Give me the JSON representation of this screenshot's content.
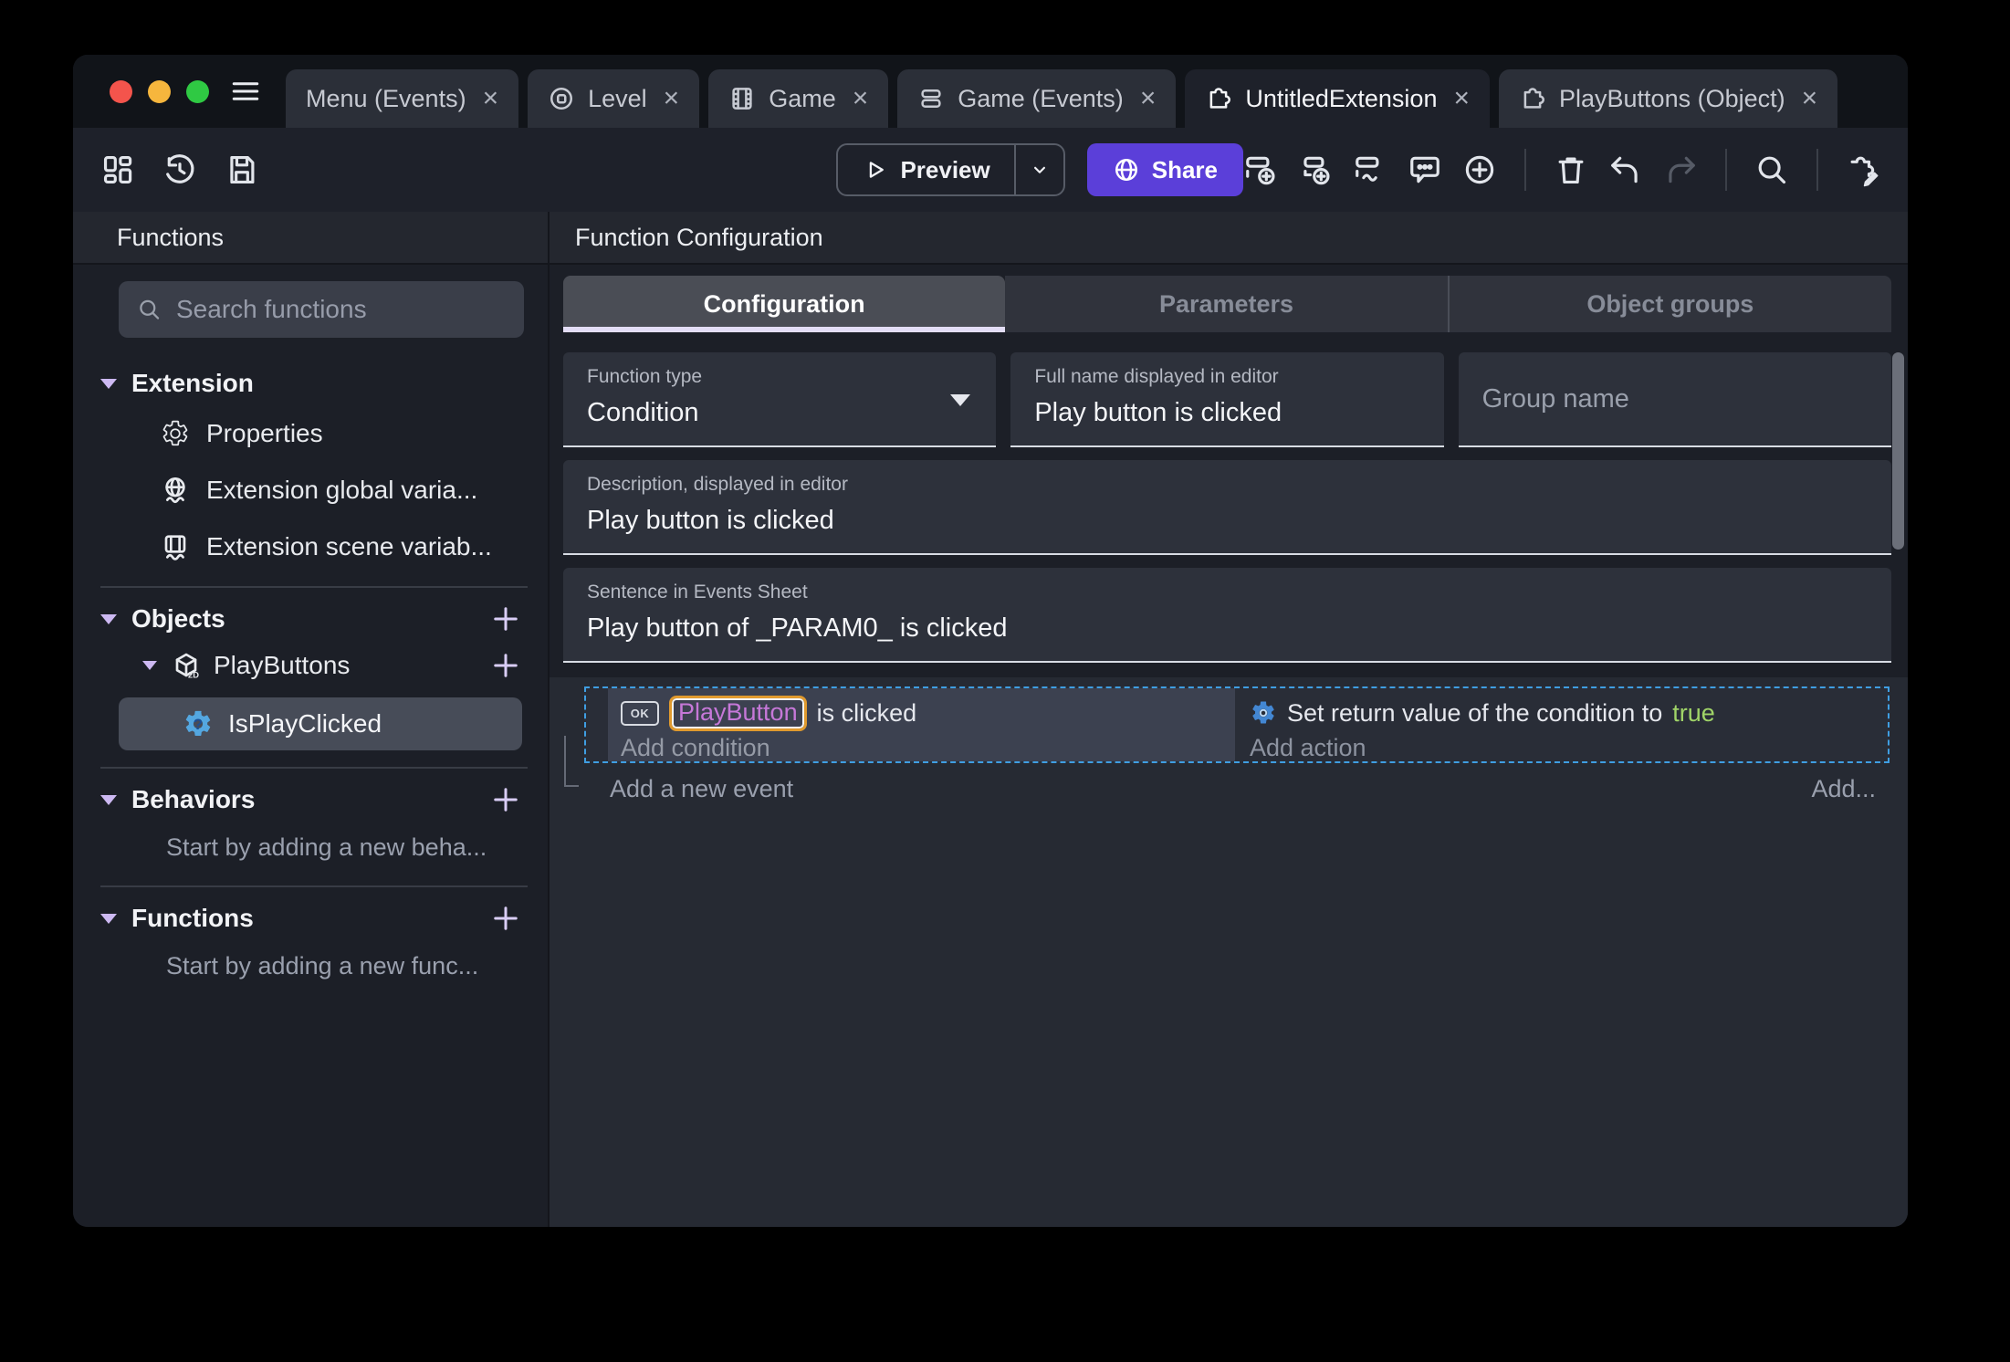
{
  "colors": {
    "accent_purple": "#5b3fd9",
    "accent_lavender": "#d9cdf6",
    "selection_blue": "#3f9ee2",
    "object_highlight_orange": "#e09a2e",
    "object_text_violet": "#c678d8",
    "true_green": "#a0d468",
    "traffic_red": "#f4544c",
    "traffic_yellow": "#f6b63d",
    "traffic_green": "#2fc943"
  },
  "tabbar": {
    "close_glyph": "×",
    "tabs": [
      {
        "label": "Menu (Events)"
      },
      {
        "label": "Level"
      },
      {
        "label": "Game"
      },
      {
        "label": "Game (Events)"
      },
      {
        "label": "UntitledExtension"
      },
      {
        "label": "PlayButtons (Object)"
      }
    ]
  },
  "toolbar": {
    "preview": "Preview",
    "share": "Share"
  },
  "sidebar": {
    "title": "Functions",
    "search_placeholder": "Search functions",
    "extension_section": {
      "label": "Extension",
      "items": [
        {
          "label": "Properties"
        },
        {
          "label": "Extension global varia..."
        },
        {
          "label": "Extension scene variab..."
        }
      ]
    },
    "objects_section": {
      "label": "Objects",
      "object": "PlayButtons",
      "function": "IsPlayClicked"
    },
    "behaviors_section": {
      "label": "Behaviors",
      "hint": "Start by adding a new beha..."
    },
    "functions_section": {
      "label": "Functions",
      "hint": "Start by adding a new func..."
    }
  },
  "main": {
    "title": "Function Configuration",
    "tabs": [
      {
        "label": "Configuration"
      },
      {
        "label": "Parameters"
      },
      {
        "label": "Object groups"
      }
    ],
    "fields": {
      "function_type_label": "Function type",
      "function_type_value": "Condition",
      "full_name_label": "Full name displayed in editor",
      "full_name_value": "Play button is clicked",
      "group_name_placeholder": "Group name",
      "description_label": "Description, displayed in editor",
      "description_value": "Play button is clicked",
      "sentence_label": "Sentence in Events Sheet",
      "sentence_value": "Play button of _PARAM0_ is clicked"
    },
    "events": {
      "condition_object_icon": "OK",
      "condition_object": "PlayButton",
      "condition_text": "is clicked",
      "add_condition": "Add condition",
      "action_text": "Set return value of the condition to",
      "action_value": "true",
      "add_action": "Add action",
      "add_event": "Add a new event",
      "add_more": "Add...",
      "function_icon_glyph": "?"
    }
  }
}
